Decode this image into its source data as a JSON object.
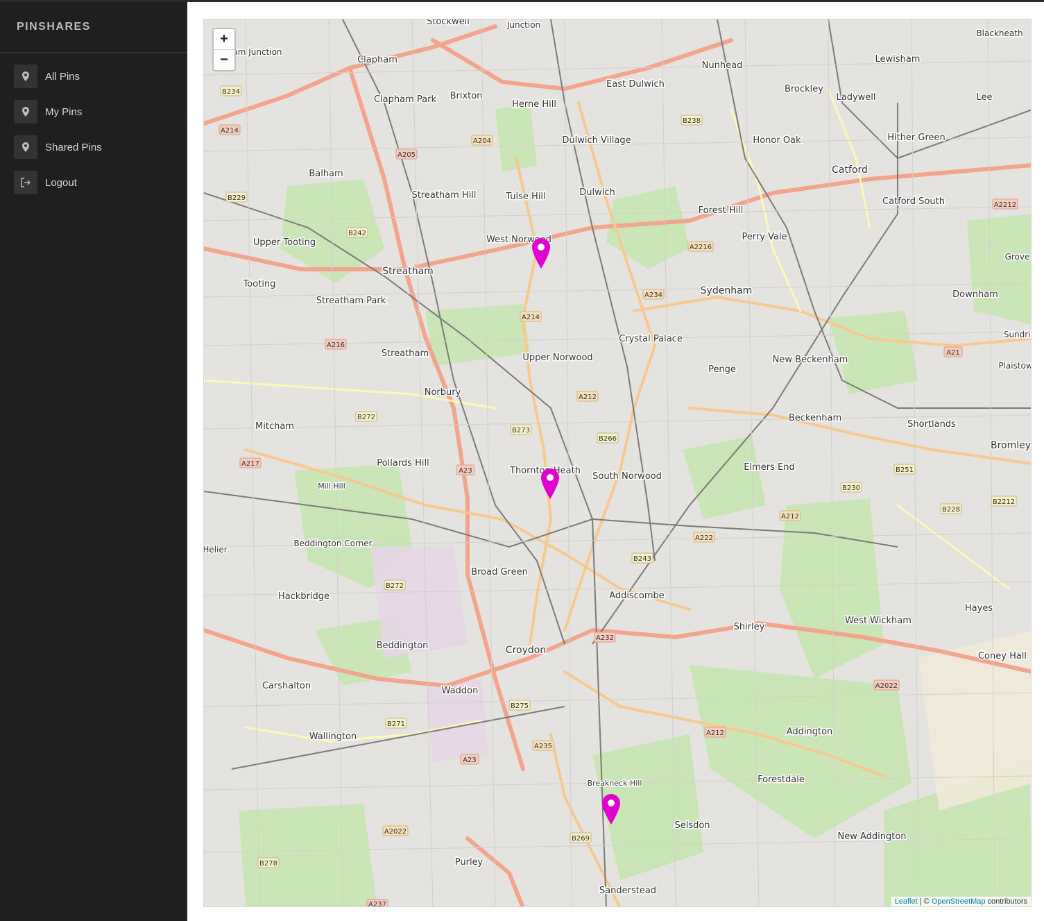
{
  "app": {
    "brand": "PINSHARES"
  },
  "sidebar": {
    "items": [
      {
        "label": "All Pins",
        "icon": "map-marker-icon"
      },
      {
        "label": "My Pins",
        "icon": "map-marker-icon"
      },
      {
        "label": "Shared Pins",
        "icon": "map-marker-icon"
      },
      {
        "label": "Logout",
        "icon": "logout-icon"
      }
    ]
  },
  "map": {
    "zoom_in": "+",
    "zoom_out": "−",
    "attribution": {
      "leaflet": "Leaflet",
      "sep": " | © ",
      "osm": "OpenStreetMap",
      "suffix": " contributors"
    },
    "pin_color": "#e000d0",
    "pins": [
      {
        "name": "pin-west-norwood"
      },
      {
        "name": "pin-thornton-heath"
      },
      {
        "name": "pin-sanderstead"
      }
    ],
    "labels": {
      "stockwell": "Stockwell",
      "junction": "Junction",
      "clapham_junction": "lapham Junction",
      "clapham": "Clapham",
      "brixton": "Brixton",
      "clapham_park": "Clapham Park",
      "herne_hill": "Herne Hill",
      "east_dulwich": "East Dulwich",
      "nunhead": "Nunhead",
      "brockley": "Brockley",
      "lewisham": "Lewisham",
      "blackheath": "Blackheath",
      "ladywell": "Ladywell",
      "lee": "Lee",
      "dulwich_village": "Dulwich Village",
      "honor_oak": "Honor Oak",
      "hither_green": "Hither Green",
      "balham": "Balham",
      "streatham_hill": "Streatham Hill",
      "tulse_hill": "Tulse Hill",
      "dulwich": "Dulwich",
      "forest_hill": "Forest Hill",
      "catford": "Catford",
      "catford_south": "Catford South",
      "upper_tooting": "Upper Tooting",
      "west_norwood": "West Norwood",
      "perry_vale": "Perry Vale",
      "streatham": "Streatham",
      "sydenham": "Sydenham",
      "tooting": "Tooting",
      "streatham_park": "Streatham Park",
      "downham": "Downham",
      "crystal_palace": "Crystal Palace",
      "upper_norwood": "Upper Norwood",
      "new_beckenham": "New Beckenham",
      "penge": "Penge",
      "norbury": "Norbury",
      "mitcham": "Mitcham",
      "beckenham": "Beckenham",
      "shortlands": "Shortlands",
      "bromley": "Bromley",
      "pollards_hill": "Pollards Hill",
      "thornton_heath": "Thornton Heath",
      "south_norwood": "South Norwood",
      "elmers_end": "Elmers End",
      "beddington_corner": "Beddington Corner",
      "broad_green": "Broad Green",
      "addiscombe": "Addiscombe",
      "hackbridge": "Hackbridge",
      "west_wickham": "West Wickham",
      "shirley": "Shirley",
      "hayes": "Hayes",
      "beddington": "Beddington",
      "croydon": "Croydon",
      "coney_hall": "Coney Hall",
      "carshalton": "Carshalton",
      "waddon": "Waddon",
      "wallington": "Wallington",
      "addington": "Addington",
      "forestdale": "Forestdale",
      "selsdon": "Selsdon",
      "new_addington": "New Addington",
      "purley": "Purley",
      "sanderstead": "Sanderstead",
      "plaistow": "Plaistow",
      "grove_park": "Grove P",
      "sundridge": "Sundrid",
      "mill_hill": "Mill Hill",
      "helier": "Helier",
      "breakneck_hill": "Breakneck Hill"
    },
    "roads": [
      "A214",
      "A205",
      "A204",
      "B238",
      "A2212",
      "B242",
      "B229",
      "A2216",
      "A234",
      "A216",
      "A212",
      "B272",
      "B273",
      "B266",
      "A217",
      "A23",
      "B230",
      "B251",
      "B2212",
      "B228",
      "A222",
      "B243",
      "B272",
      "A232",
      "A2022",
      "B275",
      "B271",
      "A235",
      "B269",
      "B278",
      "A237",
      "A21",
      "B234"
    ]
  }
}
